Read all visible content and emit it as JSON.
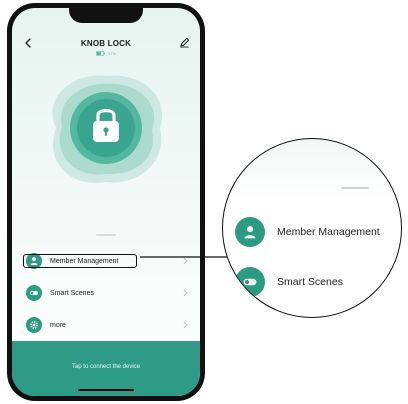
{
  "header": {
    "title": "KNOB LOCK",
    "back_icon": "chevron-left-icon",
    "edit_icon": "pencil-icon",
    "battery_icon": "battery-icon",
    "battery_percent": "57%"
  },
  "lock": {
    "icon": "padlock-icon",
    "color": "#3aa58f"
  },
  "menu": {
    "items": [
      {
        "label": "Member Management",
        "icon": "user-icon"
      },
      {
        "label": "Smart Scenes",
        "icon": "toggle-icon"
      },
      {
        "label": "more",
        "icon": "gear-icon"
      }
    ]
  },
  "connect": {
    "label": "Tap to connect the device"
  },
  "callout": {
    "items": [
      {
        "label": "Member Management",
        "icon": "user-icon"
      },
      {
        "label": "Smart Scenes",
        "icon": "toggle-icon"
      }
    ]
  },
  "colors": {
    "accent": "#2c9b84",
    "connect_bar": "#2d9b86",
    "background_tint": "#e6f3ef"
  }
}
